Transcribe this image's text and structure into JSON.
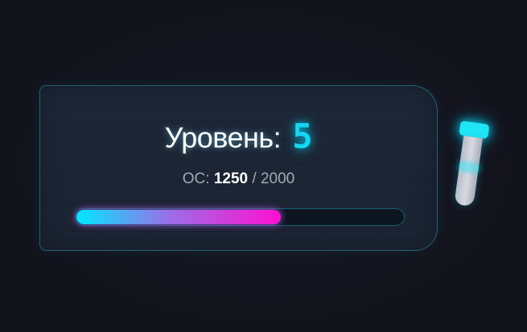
{
  "level_card": {
    "level_label": "Уровень:",
    "level_value": "5",
    "xp": {
      "prefix": "ОС:",
      "current": "1250",
      "separator": "/",
      "max": "2000"
    },
    "progress": {
      "fraction": 0.625,
      "gradient_start": "#00e8ff",
      "gradient_end": "#ff10d0"
    }
  },
  "side_item": {
    "icon": "vial-icon",
    "cap_color": "#1fe6f6"
  },
  "colors": {
    "background": "#14141e",
    "panel": "#1a2231",
    "accent": "#16d6f2",
    "text_secondary": "#a3a8b2"
  }
}
